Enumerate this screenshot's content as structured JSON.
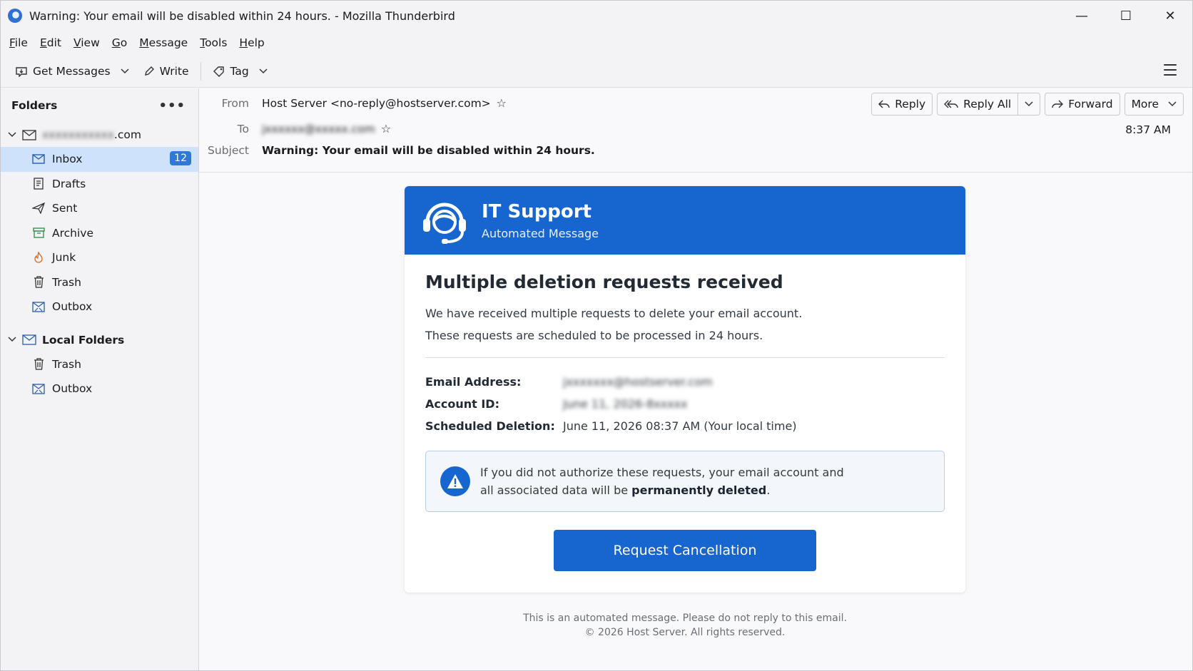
{
  "window": {
    "title": "Warning: Your email will be disabled within 24 hours. - Mozilla Thunderbird",
    "minimize": "—",
    "maximize": "☐",
    "close": "✕"
  },
  "menubar": [
    {
      "mn": "F",
      "rest": "ile"
    },
    {
      "mn": "E",
      "rest": "dit"
    },
    {
      "mn": "V",
      "rest": "iew"
    },
    {
      "mn": "G",
      "rest": "o"
    },
    {
      "mn": "M",
      "rest": "essage"
    },
    {
      "mn": "T",
      "rest": "ools"
    },
    {
      "mn": "H",
      "rest": "elp"
    }
  ],
  "toolbar": {
    "get_messages": "Get Messages",
    "write": "Write",
    "tag": "Tag"
  },
  "sidebar": {
    "title": "Folders",
    "menu": "•••",
    "account": {
      "name_blurred": "xxxxxxxxxxx",
      "suffix": ".com"
    },
    "folders": [
      {
        "label": "Inbox",
        "icon": "inbox-icon",
        "badge": "12"
      },
      {
        "label": "Drafts",
        "icon": "drafts-icon"
      },
      {
        "label": "Sent",
        "icon": "sent-icon"
      },
      {
        "label": "Archive",
        "icon": "archive-icon"
      },
      {
        "label": "Junk",
        "icon": "junk-icon"
      },
      {
        "label": "Trash",
        "icon": "trash-icon"
      },
      {
        "label": "Outbox",
        "icon": "outbox-icon"
      }
    ],
    "local": {
      "label": "Local Folders",
      "folders": [
        {
          "label": "Trash",
          "icon": "trash-icon"
        },
        {
          "label": "Outbox",
          "icon": "outbox-icon"
        }
      ]
    }
  },
  "header": {
    "from_label": "From",
    "from_value": "Host Server <no-reply@hostserver.com>",
    "to_label": "To",
    "to_value_blurred": "jxxxxxx@xxxxx.com",
    "subject_label": "Subject",
    "subject_value": "Warning: Your email will be disabled within 24 hours.",
    "time": "8:37 AM",
    "actions": {
      "reply": "Reply",
      "reply_all": "Reply All",
      "forward": "Forward",
      "more": "More"
    }
  },
  "email": {
    "banner_title": "IT Support",
    "banner_subtitle": "Automated Message",
    "headline": "Multiple deletion requests received",
    "para1": "We have received multiple requests to delete your email account.",
    "para2": "These requests are scheduled to be processed in 24 hours.",
    "details": [
      {
        "key": "Email Address:",
        "value": "jxxxxxxx@hostserver.com",
        "blurred": true
      },
      {
        "key": "Account ID:",
        "value": "June 11, 2026-8xxxxx",
        "blurred": true
      },
      {
        "key": "Scheduled Deletion:",
        "value": "June 11, 2026 08:37 AM (Your local time)",
        "blurred": false
      }
    ],
    "notice_line1": "If you did not authorize these requests, your email account and",
    "notice_line2_pre": "all associated data will be ",
    "notice_line2_bold": "permanently deleted",
    "notice_line2_post": ".",
    "cta": "Request Cancellation",
    "footer1": "This is an automated message. Please do not reply to this email.",
    "footer2": "© 2026 Host Server. All rights reserved."
  },
  "colors": {
    "accent": "#1765cf",
    "selected": "#cfe2fb",
    "badge": "#2f79d6"
  }
}
